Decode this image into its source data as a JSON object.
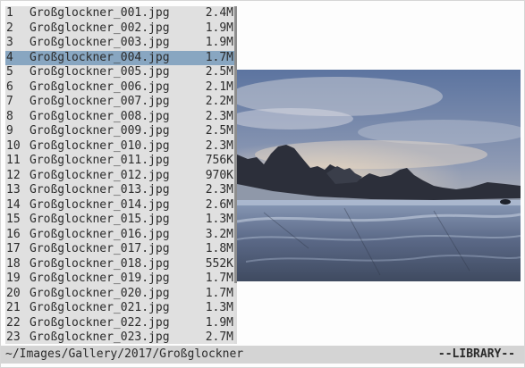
{
  "file_list": {
    "selected_index": 3,
    "scroll_fraction_visible": 0.82,
    "rows": [
      {
        "num": "1",
        "name": "Großglockner_001.jpg",
        "size": "2.4M"
      },
      {
        "num": "2",
        "name": "Großglockner_002.jpg",
        "size": "1.9M"
      },
      {
        "num": "3",
        "name": "Großglockner_003.jpg",
        "size": "1.9M"
      },
      {
        "num": "4",
        "name": "Großglockner_004.jpg",
        "size": "1.7M"
      },
      {
        "num": "5",
        "name": "Großglockner_005.jpg",
        "size": "2.5M"
      },
      {
        "num": "6",
        "name": "Großglockner_006.jpg",
        "size": "2.1M"
      },
      {
        "num": "7",
        "name": "Großglockner_007.jpg",
        "size": "2.2M"
      },
      {
        "num": "8",
        "name": "Großglockner_008.jpg",
        "size": "2.3M"
      },
      {
        "num": "9",
        "name": "Großglockner_009.jpg",
        "size": "2.5M"
      },
      {
        "num": "10",
        "name": "Großglockner_010.jpg",
        "size": "2.3M"
      },
      {
        "num": "11",
        "name": "Großglockner_011.jpg",
        "size": "756K"
      },
      {
        "num": "12",
        "name": "Großglockner_012.jpg",
        "size": "970K"
      },
      {
        "num": "13",
        "name": "Großglockner_013.jpg",
        "size": "2.3M"
      },
      {
        "num": "14",
        "name": "Großglockner_014.jpg",
        "size": "2.6M"
      },
      {
        "num": "15",
        "name": "Großglockner_015.jpg",
        "size": "1.3M"
      },
      {
        "num": "16",
        "name": "Großglockner_016.jpg",
        "size": "3.2M"
      },
      {
        "num": "17",
        "name": "Großglockner_017.jpg",
        "size": "1.8M"
      },
      {
        "num": "18",
        "name": "Großglockner_018.jpg",
        "size": "552K"
      },
      {
        "num": "19",
        "name": "Großglockner_019.jpg",
        "size": "1.7M"
      },
      {
        "num": "20",
        "name": "Großglockner_020.jpg",
        "size": "1.7M"
      },
      {
        "num": "21",
        "name": "Großglockner_021.jpg",
        "size": "1.3M"
      },
      {
        "num": "22",
        "name": "Großglockner_022.jpg",
        "size": "1.9M"
      },
      {
        "num": "23",
        "name": "Großglockner_023.jpg",
        "size": "2.7M"
      }
    ]
  },
  "status_bar": {
    "path": "~/Images/Gallery/2017/Großglockner",
    "mode": "--LIBRARY--"
  },
  "colors": {
    "list_background": "#e0e0e0",
    "selection": "#88a6c1",
    "status_background": "#d4d4d4",
    "text": "#2b2b2b"
  }
}
